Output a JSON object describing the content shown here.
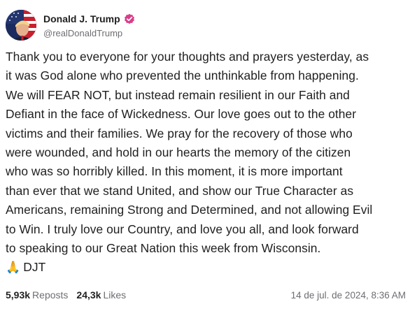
{
  "author": {
    "display_name": "Donald J. Trump",
    "handle": "@realDonaldTrump",
    "verified": true,
    "verified_color": "#d93d8a"
  },
  "post": {
    "lines": [
      "Thank you to everyone for your thoughts and prayers yesterday, as",
      "it was God alone who prevented the unthinkable from happening.",
      "We will FEAR NOT, but instead remain resilient in our Faith and",
      "Defiant in the face of Wickedness. Our love goes out to the other",
      "victims and their families. We pray for the recovery of those who",
      "were wounded, and hold in our hearts the memory of the citizen",
      "who was so horribly killed. In this moment, it is more important",
      "than ever that we stand United, and show our True Character as",
      "Americans, remaining Strong and Determined, and not allowing Evil",
      "to Win. I truly love our Country, and love you all, and look forward",
      "to speaking to our Great Nation this week from Wisconsin."
    ],
    "signature_emoji": "🙏",
    "signature": "DJT"
  },
  "stats": {
    "reposts_count": "5,93k",
    "reposts_label": "Reposts",
    "likes_count": "24,3k",
    "likes_label": "Likes"
  },
  "timestamp": "14 de jul. de 2024, 8:36 AM"
}
